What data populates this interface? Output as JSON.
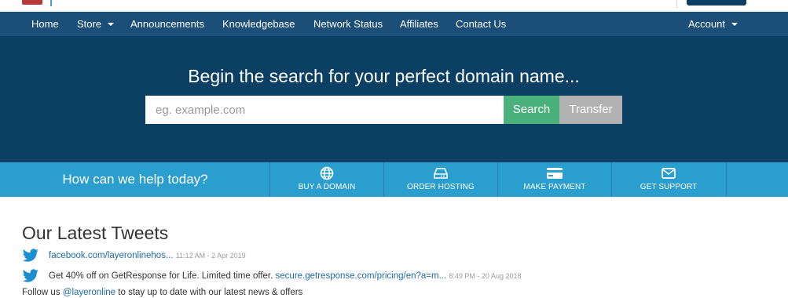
{
  "colors": {
    "navbar_bg": "#1b4f78",
    "hero_bg": "#0b3f64",
    "help_bar_bg": "#2a9fcf",
    "search_button": "#4bb17c",
    "transfer_button": "#b2b2b2",
    "link": "#1f6ba6"
  },
  "nav": {
    "items": [
      "Home",
      "Store",
      "Announcements",
      "Knowledgebase",
      "Network Status",
      "Affiliates",
      "Contact Us"
    ],
    "account": "Account"
  },
  "hero": {
    "title": "Begin the search for your perfect domain name...",
    "search_placeholder": "eg. example.com",
    "search_button": "Search",
    "transfer_button": "Transfer"
  },
  "help": {
    "title": "How can we help today?",
    "items": [
      {
        "label": "BUY A DOMAIN",
        "icon": "globe-icon"
      },
      {
        "label": "ORDER HOSTING",
        "icon": "hard-drive-icon"
      },
      {
        "label": "MAKE PAYMENT",
        "icon": "credit-card-icon"
      },
      {
        "label": "GET SUPPORT",
        "icon": "envelope-icon"
      }
    ]
  },
  "tweets": {
    "title": "Our Latest Tweets",
    "items": [
      {
        "text": "",
        "link": "facebook.com/layeronlinehos...",
        "date": "11:12 AM - 2 Apr 2019",
        "icon": "twitter-icon"
      },
      {
        "text": "Get 40% off on GetResponse for Life. Limited time offer.",
        "link": "secure.getresponse.com/pricing/en?a=m...",
        "date": "8:49 PM - 20 Aug 2018",
        "icon": "twitter-icon"
      }
    ],
    "follow_prefix": "Follow us",
    "follow_handle": "@layeronline",
    "follow_suffix": "to stay up to date with our latest news & offers"
  }
}
